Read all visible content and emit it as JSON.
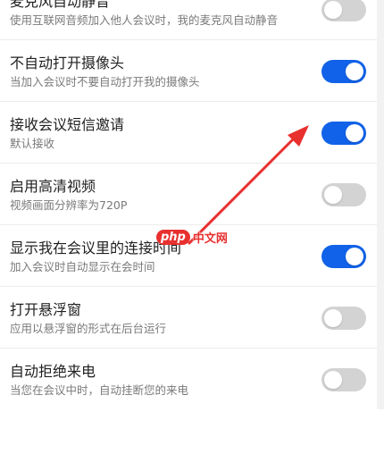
{
  "settings": {
    "items": [
      {
        "title": "麦克风自动静音",
        "subtitle": "使用互联网音频加入他人会议时，我的麦克风自动静音",
        "enabled": false
      },
      {
        "title": "不自动打开摄像头",
        "subtitle": "当加入会议时不要自动打开我的摄像头",
        "enabled": true
      },
      {
        "title": "接收会议短信邀请",
        "subtitle": "默认接收",
        "enabled": true
      },
      {
        "title": "启用高清视频",
        "subtitle": "视频画面分辨率为720P",
        "enabled": false
      },
      {
        "title": "显示我在会议里的连接时间",
        "subtitle": "加入会议时自动显示在会时间",
        "enabled": true
      },
      {
        "title": "打开悬浮窗",
        "subtitle": "应用以悬浮窗的形式在后台运行",
        "enabled": false
      },
      {
        "title": "自动拒绝来电",
        "subtitle": "当您在会议中时，自动挂断您的来电",
        "enabled": false
      }
    ]
  },
  "colors": {
    "toggle_on": "#1162e8",
    "toggle_off": "#d3d3d3",
    "arrow": "#e8302f"
  },
  "watermark": {
    "logo_text": "php",
    "site_text": "中文网"
  }
}
